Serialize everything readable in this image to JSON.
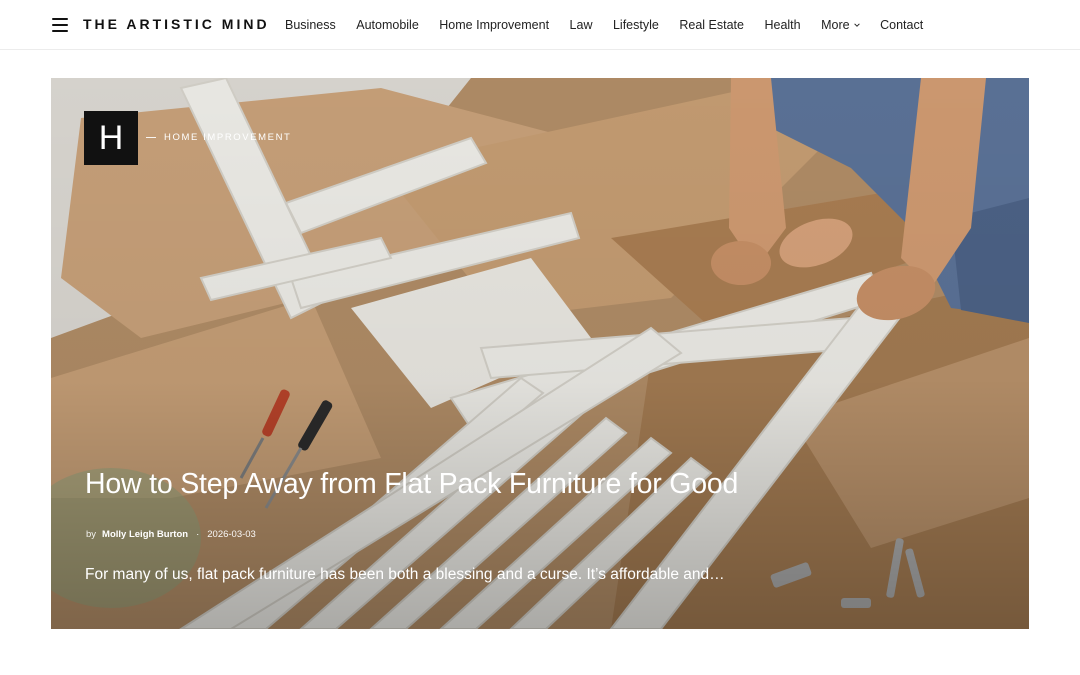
{
  "site": {
    "logo_text": "THE ARTISTIC MIND"
  },
  "nav": {
    "items": [
      {
        "label": "Business"
      },
      {
        "label": "Automobile"
      },
      {
        "label": "Home Improvement"
      },
      {
        "label": "Law"
      },
      {
        "label": "Lifestyle"
      },
      {
        "label": "Real Estate"
      },
      {
        "label": "Health"
      },
      {
        "label": "More"
      },
      {
        "label": "Contact"
      }
    ]
  },
  "featured": {
    "badge_letter": "H",
    "category": "HOME IMPROVEMENT",
    "title": "How to Step Away from Flat Pack Furniture for Good",
    "by_label": "by",
    "author": "Molly Leigh Burton",
    "separator": "·",
    "date": "2026-03-03",
    "excerpt": "For many of us, flat pack furniture has been both a blessing and a curse. It’s affordable and…"
  }
}
